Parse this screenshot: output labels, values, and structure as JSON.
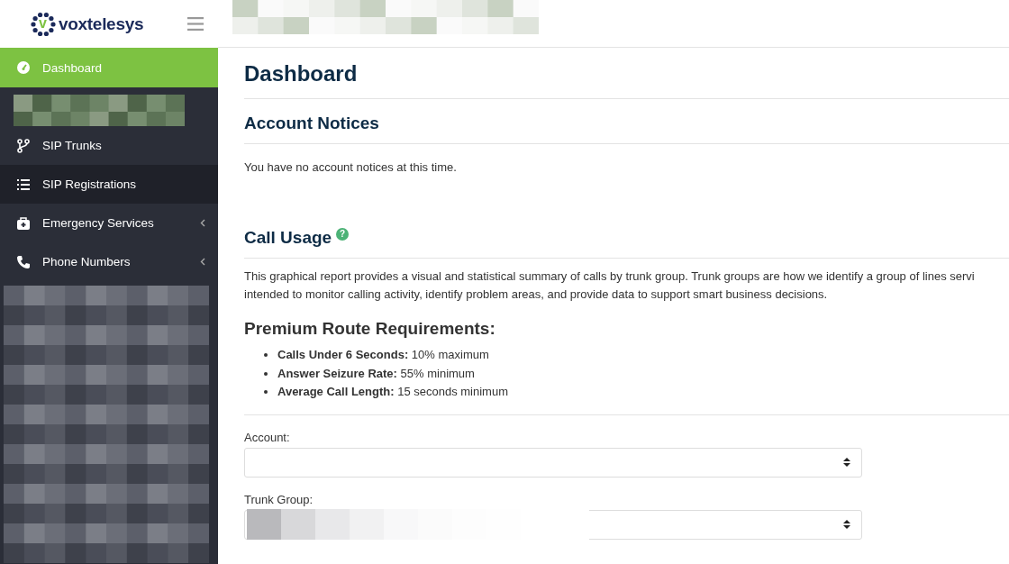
{
  "logo": {
    "mark": "v",
    "name": "voxtelesys"
  },
  "sidebar": {
    "items": [
      {
        "label": "Dashboard",
        "selected": true,
        "expandable": false
      },
      {
        "label": "SIP Trunks",
        "selected": false,
        "expandable": false
      },
      {
        "label": "SIP Registrations",
        "selected": false,
        "hovered": true,
        "expandable": false
      },
      {
        "label": "Emergency Services",
        "selected": false,
        "expandable": true
      },
      {
        "label": "Phone Numbers",
        "selected": false,
        "expandable": true
      }
    ]
  },
  "page": {
    "title": "Dashboard",
    "sections": [
      {
        "kind": "notices",
        "title": "Account Notices",
        "text": "You have no account notices at this time."
      },
      {
        "kind": "usage",
        "title": "Call Usage",
        "help": "?",
        "paragraph": [
          "This graphical report provides a visual and statistical summary of calls by trunk group. Trunk groups are how we identify a group of lines servi",
          "intended to monitor calling activity, identify problem areas, and provide data to support smart business decisions."
        ],
        "subtitle": "Premium Route Requirements:",
        "requirements": [
          "**Calls Under 6 Seconds:** 10% maximum",
          "**Answer Seizure Rate:** 55% minimum",
          "**Average Call Length:** 15 seconds minimum"
        ],
        "fields": [
          {
            "label": "Account:"
          },
          {
            "label": "Trunk Group:",
            "kind": "picture"
          }
        ]
      }
    ]
  }
}
